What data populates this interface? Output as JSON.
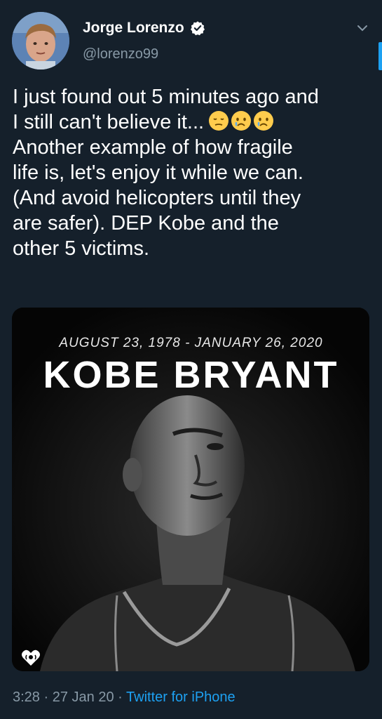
{
  "tweet": {
    "author": {
      "display_name": "Jorge Lorenzo",
      "handle": "@lorenzo99",
      "verified": true,
      "verified_icon": "verified-badge-icon"
    },
    "text_line1": "I just found out 5 minutes ago and\nI still can't believe it...",
    "emojis": [
      "😔",
      "😢",
      "😢"
    ],
    "text_line2": "Another example of how fragile\nlife is, let's enjoy it while we can.\n(And avoid helicopters until they\nare safer). DEP Kobe and the\nother 5 victims.",
    "media": {
      "dates": "AUGUST 23, 1978 - JANUARY 26, 2020",
      "title": "KOBE  BRYANT",
      "logo_icon": "iheart-logo-icon"
    },
    "footer": {
      "time": "3:28",
      "separator": "·",
      "date": "27 Jan 20",
      "source": "Twitter for iPhone"
    }
  },
  "colors": {
    "background": "#15202b",
    "secondary_text": "#8899a6",
    "accent": "#1da1f2"
  }
}
